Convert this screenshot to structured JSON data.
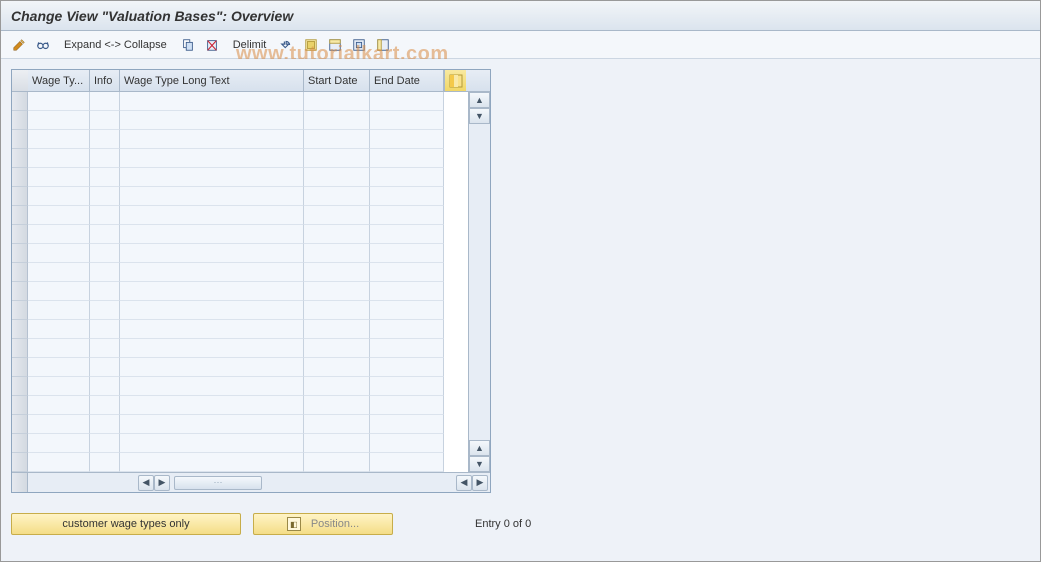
{
  "window": {
    "title": "Change View \"Valuation Bases\": Overview"
  },
  "toolbar": {
    "edit_icon": "pencil-icon",
    "glasses_icon": "glasses-icon",
    "expand_label": "Expand <-> Collapse",
    "copy_icon": "copy-icon",
    "paste_icon": "paste-icon",
    "delimit_label": "Delimit",
    "undo_icon": "undo-icon",
    "select_all_icon": "select-all-icon",
    "select_block_icon": "select-block-icon",
    "deselect_icon": "deselect-icon",
    "table_settings_icon": "table-settings-icon"
  },
  "grid": {
    "columns": {
      "wage_type": "Wage Ty...",
      "info": "Info",
      "wage_long": "Wage Type Long Text",
      "start_date": "Start Date",
      "end_date": "End Date"
    },
    "rows": [
      {},
      {},
      {},
      {},
      {},
      {},
      {},
      {},
      {},
      {},
      {},
      {},
      {},
      {},
      {},
      {},
      {},
      {},
      {},
      {}
    ],
    "configure_icon": "configure-columns-icon"
  },
  "footer": {
    "customer_btn": "customer wage types only",
    "position_btn": "Position...",
    "entry_text": "Entry 0 of 0"
  },
  "watermark": "www.tutorialkart.com"
}
